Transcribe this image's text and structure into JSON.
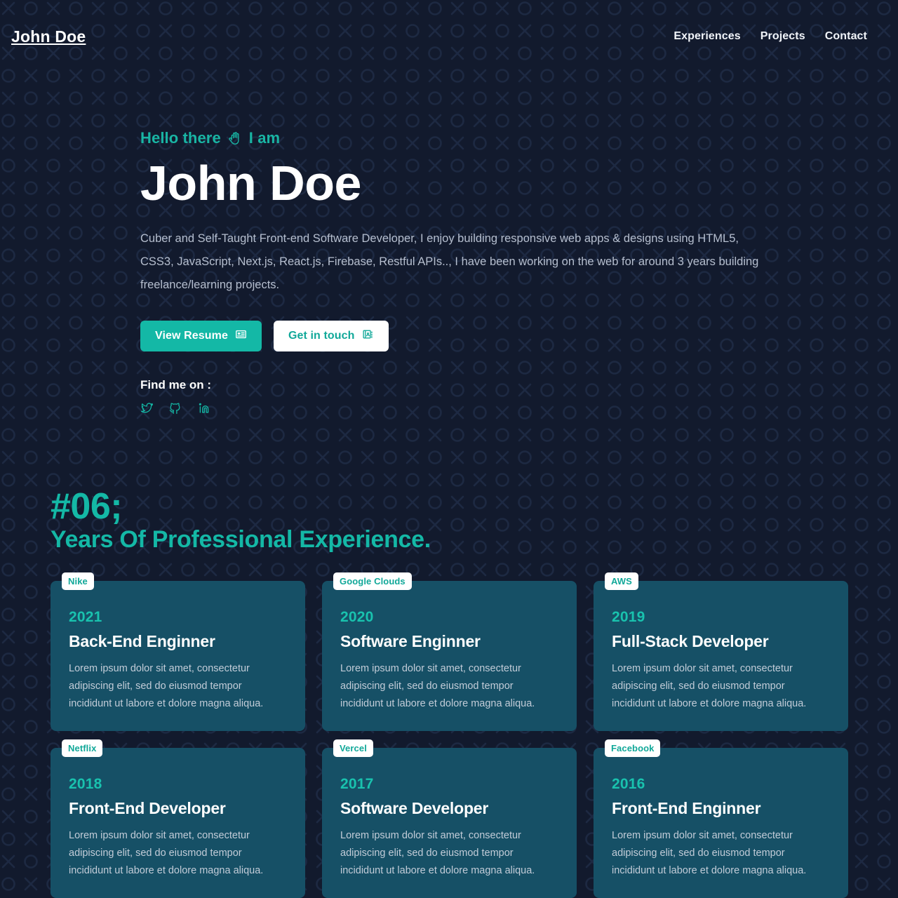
{
  "theme": {
    "background": "#121a2d",
    "accent_teal": "#14b8a6",
    "card_background": "#165066",
    "text_primary": "#ffffff",
    "text_muted": "#b6bfcf"
  },
  "header": {
    "brand": "John Doe",
    "nav": [
      {
        "label": "Experiences"
      },
      {
        "label": "Projects"
      },
      {
        "label": "Contact"
      }
    ]
  },
  "hero": {
    "greeting_before": "Hello there",
    "greeting_icon": "waving-hand-icon",
    "greeting_after": "I am",
    "name": "John Doe",
    "description": "Cuber and Self-Taught Front-end Software Developer, I enjoy building responsive web apps & designs using HTML5, CSS3, JavaScript, Next.js, React.js, Firebase, Restful APIs.., I have been working on the web for around 3 years building freelance/learning projects.",
    "primary_button": {
      "label": "View Resume",
      "icon": "identification-card-icon"
    },
    "secondary_button": {
      "label": "Get in touch",
      "icon": "card-index-icon"
    },
    "find_me_label": "Find me on :",
    "socials": [
      {
        "name": "twitter",
        "icon": "twitter-icon"
      },
      {
        "name": "github",
        "icon": "github-icon"
      },
      {
        "name": "linkedin",
        "icon": "linkedin-icon"
      }
    ]
  },
  "experience": {
    "count": "#06;",
    "heading": "Years Of Professional Experience.",
    "cards": [
      {
        "company": "Nike",
        "year": "2021",
        "role": "Back-End Enginner",
        "description": "Lorem ipsum dolor sit amet, consectetur adipiscing elit, sed do eiusmod tempor incididunt ut labore et dolore magna aliqua."
      },
      {
        "company": "Google Clouds",
        "year": "2020",
        "role": "Software Enginner",
        "description": "Lorem ipsum dolor sit amet, consectetur adipiscing elit, sed do eiusmod tempor incididunt ut labore et dolore magna aliqua."
      },
      {
        "company": "AWS",
        "year": "2019",
        "role": "Full-Stack Developer",
        "description": "Lorem ipsum dolor sit amet, consectetur adipiscing elit, sed do eiusmod tempor incididunt ut labore et dolore magna aliqua."
      },
      {
        "company": "Netflix",
        "year": "2018",
        "role": "Front-End Developer",
        "description": "Lorem ipsum dolor sit amet, consectetur adipiscing elit, sed do eiusmod tempor incididunt ut labore et dolore magna aliqua."
      },
      {
        "company": "Vercel",
        "year": "2017",
        "role": "Software Developer",
        "description": "Lorem ipsum dolor sit amet, consectetur adipiscing elit, sed do eiusmod tempor incididunt ut labore et dolore magna aliqua."
      },
      {
        "company": "Facebook",
        "year": "2016",
        "role": "Front-End Enginner",
        "description": "Lorem ipsum dolor sit amet, consectetur adipiscing elit, sed do eiusmod tempor incididunt ut labore et dolore magna aliqua."
      }
    ]
  }
}
